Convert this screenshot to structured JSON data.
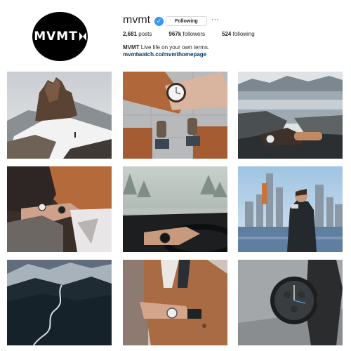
{
  "profile": {
    "username": "mvmt",
    "avatar_text": "MVMT",
    "verified_icon": "verified-badge-icon",
    "following_label": "Following",
    "more_label": "···",
    "stats": {
      "posts_count": "2,681",
      "posts_label": "posts",
      "followers_count": "967k",
      "followers_label": "followers",
      "following_count": "524",
      "following_label": "following"
    },
    "bio": {
      "name": "MVMT",
      "text": "Live life on your own terms.",
      "link": "mvmtwatch.co/mvmthomepage"
    }
  },
  "posts": [
    "post-mountain-hiker",
    "post-wrist-watch-sneakers",
    "post-lake-watch",
    "post-couple-watches",
    "post-car-steering-watch",
    "post-city-man",
    "post-mountain-river",
    "post-coat-watch",
    "post-watch-product"
  ],
  "colors": {
    "accent_blue": "#3897f0",
    "link_blue": "#003569",
    "text": "#262626"
  }
}
